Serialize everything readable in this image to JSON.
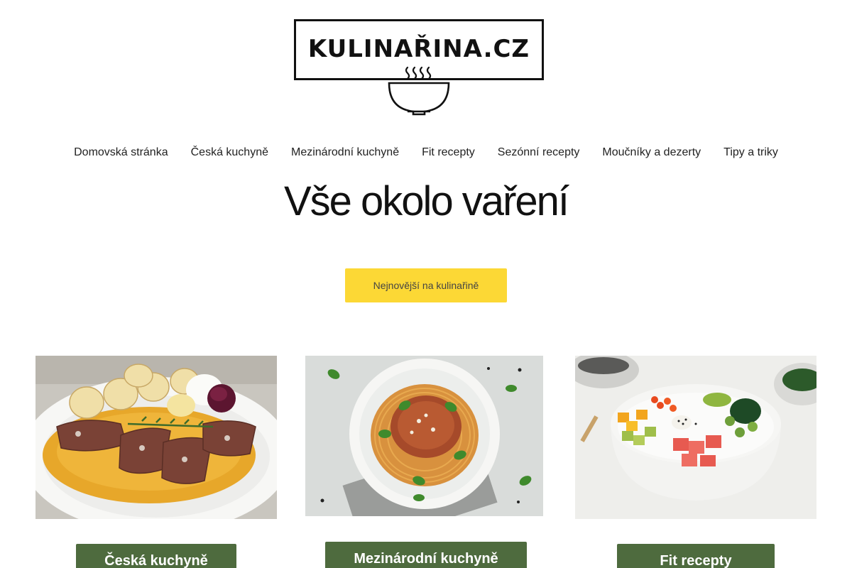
{
  "logo": {
    "text": "KULINAŘINA.CZ"
  },
  "nav": {
    "items": [
      {
        "label": "Domovská stránka"
      },
      {
        "label": "Česká kuchyně"
      },
      {
        "label": "Mezinárodní kuchyně"
      },
      {
        "label": "Fit recepty"
      },
      {
        "label": "Sezónní recepty"
      },
      {
        "label": "Moučníky a dezerty"
      },
      {
        "label": "Tipy a triky"
      }
    ]
  },
  "hero": {
    "title": "Vše okolo vaření"
  },
  "cta": {
    "label": "Nejnovější na kulinařině",
    "color": "#fcd835"
  },
  "categories": [
    {
      "label": "Česká kuchyně",
      "image": "svickova-image"
    },
    {
      "label": "Mezinárodní kuchyně",
      "image": "spaghetti-bolognese-image"
    },
    {
      "label": "Fit recepty",
      "image": "poke-bowl-image"
    }
  ],
  "colors": {
    "category_button": "#4e6b3e",
    "text": "#222222"
  }
}
